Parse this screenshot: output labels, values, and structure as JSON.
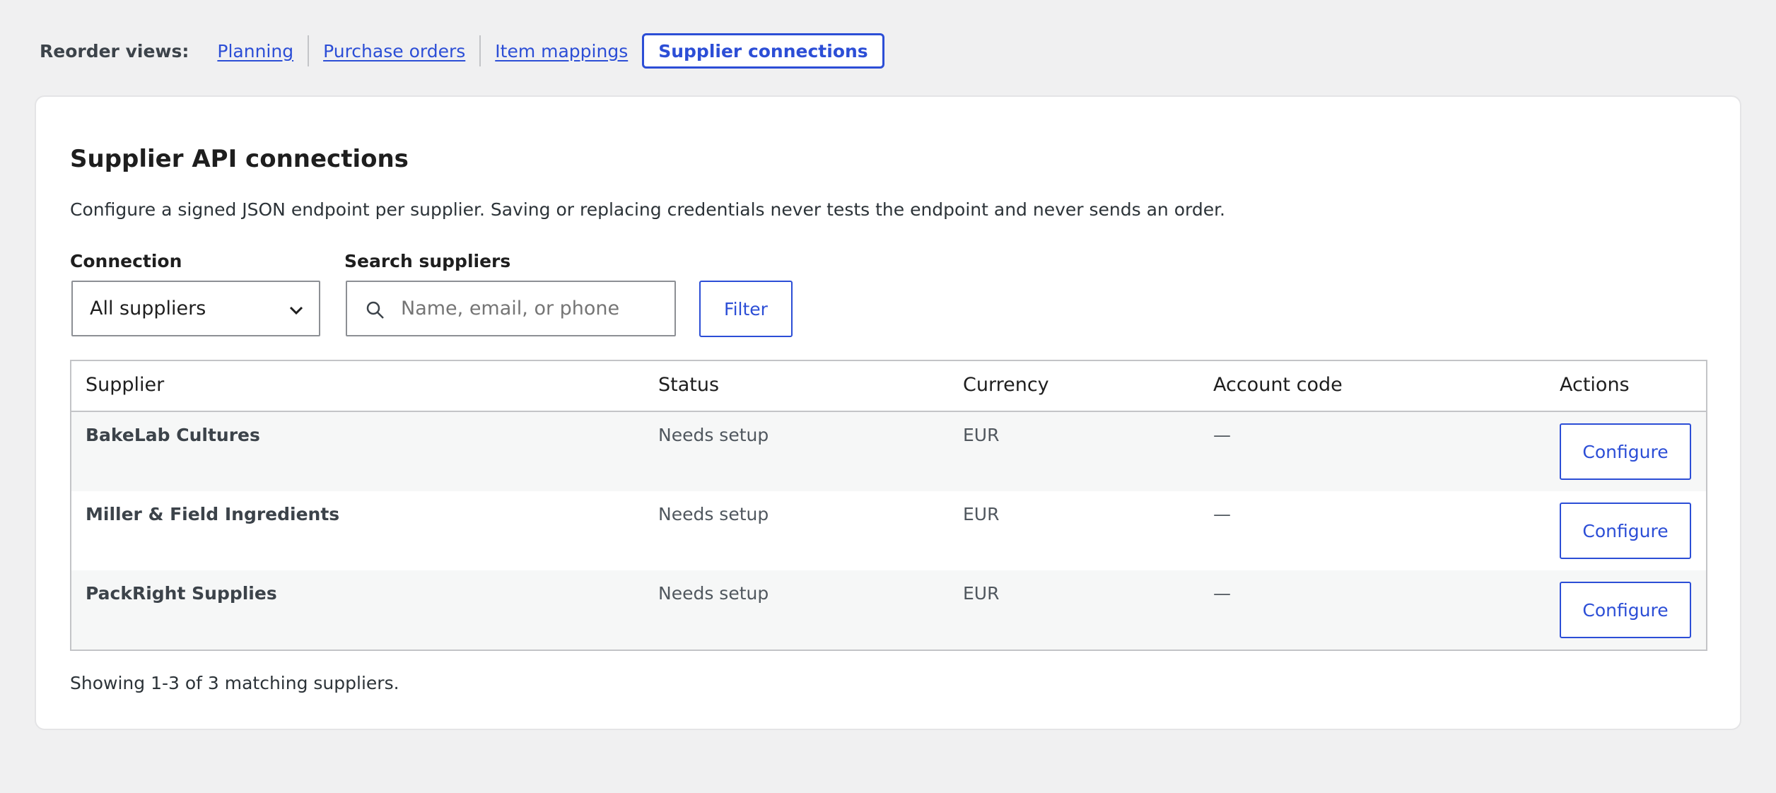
{
  "nav": {
    "label": "Reorder views:",
    "links": [
      "Planning",
      "Purchase orders",
      "Item mappings"
    ],
    "current": "Supplier connections"
  },
  "panel": {
    "title": "Supplier API connections",
    "description": "Configure a signed JSON endpoint per supplier. Saving or replacing credentials never tests the endpoint and never sends an order."
  },
  "filters": {
    "connection_label": "Connection",
    "connection_value": "All suppliers",
    "search_label": "Search suppliers",
    "search_placeholder": "Name, email, or phone",
    "search_value": "",
    "filter_button": "Filter"
  },
  "table": {
    "headers": [
      "Supplier",
      "Status",
      "Currency",
      "Account code",
      "Actions"
    ],
    "rows": [
      {
        "supplier": "BakeLab Cultures",
        "status": "Needs setup",
        "currency": "EUR",
        "account_code": "—",
        "action": "Configure"
      },
      {
        "supplier": "Miller & Field Ingredients",
        "status": "Needs setup",
        "currency": "EUR",
        "account_code": "—",
        "action": "Configure"
      },
      {
        "supplier": "PackRight Supplies",
        "status": "Needs setup",
        "currency": "EUR",
        "account_code": "—",
        "action": "Configure"
      }
    ]
  },
  "footer": {
    "showing": "Showing 1-3 of 3 matching suppliers."
  },
  "colors": {
    "accent": "#2c4ed6",
    "background": "#f0f0f1",
    "row_alt": "#f6f7f7"
  },
  "icons": [
    "chevron-down-icon",
    "search-icon"
  ]
}
